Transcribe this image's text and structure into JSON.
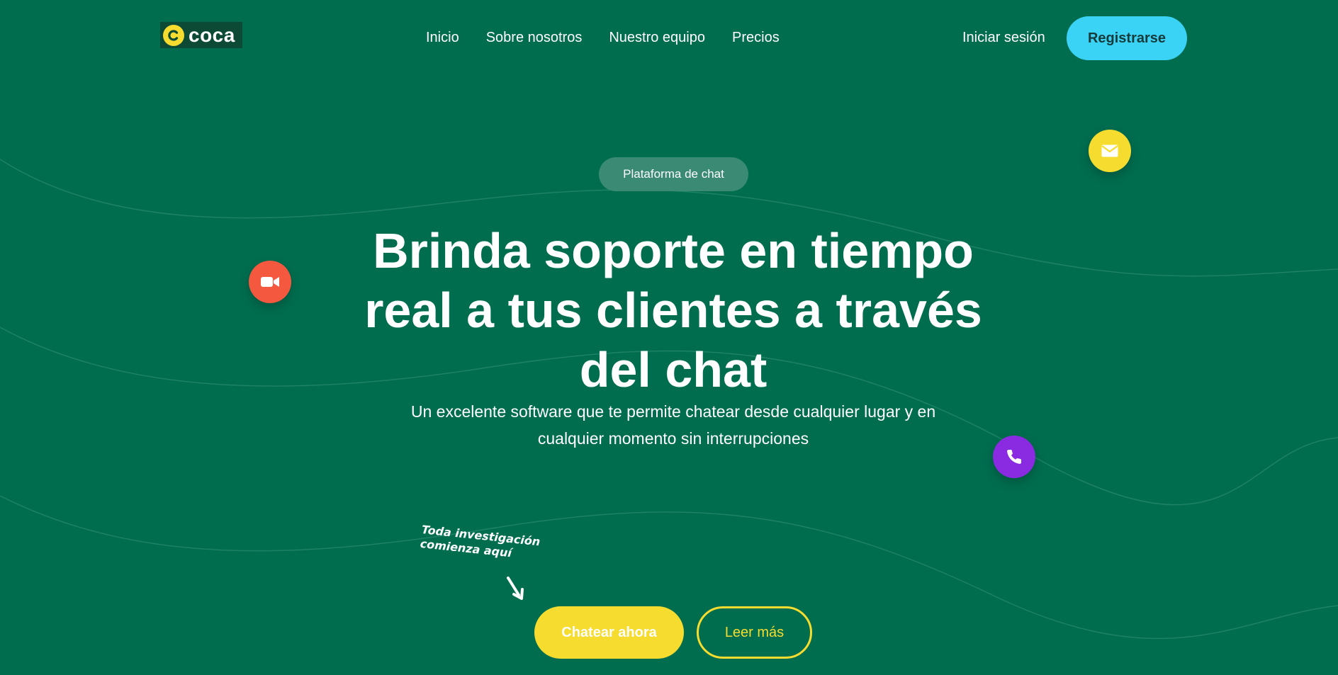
{
  "brand": {
    "name": "coca",
    "mark": "C"
  },
  "nav": {
    "items": [
      {
        "label": "Inicio"
      },
      {
        "label": "Sobre nosotros"
      },
      {
        "label": "Nuestro equipo"
      },
      {
        "label": "Precios"
      }
    ]
  },
  "auth": {
    "signin_label": "Iniciar sesión",
    "register_label": "Registrarse"
  },
  "hero": {
    "badge": "Plataforma de chat",
    "headline": "Brinda soporte en tiempo real a tus clientes a través del chat",
    "subtitle": "Un excelente software que te permite chatear desde cualquier lugar y en cualquier momento sin interrupciones",
    "note": "Toda investigación comienza aquí",
    "primary_cta": "Chatear ahora",
    "secondary_cta": "Leer más"
  },
  "icons": {
    "video": "video-camera-icon",
    "mail": "envelope-icon",
    "phone": "phone-icon",
    "arrow": "arrow-down-right-icon"
  },
  "colors": {
    "background": "#006d4f",
    "accent_yellow": "#f6dc2e",
    "register_cyan": "#3ad2f5",
    "video_red": "#f4583f",
    "phone_purple": "#8a2be2",
    "badge": "#3a8a74"
  }
}
